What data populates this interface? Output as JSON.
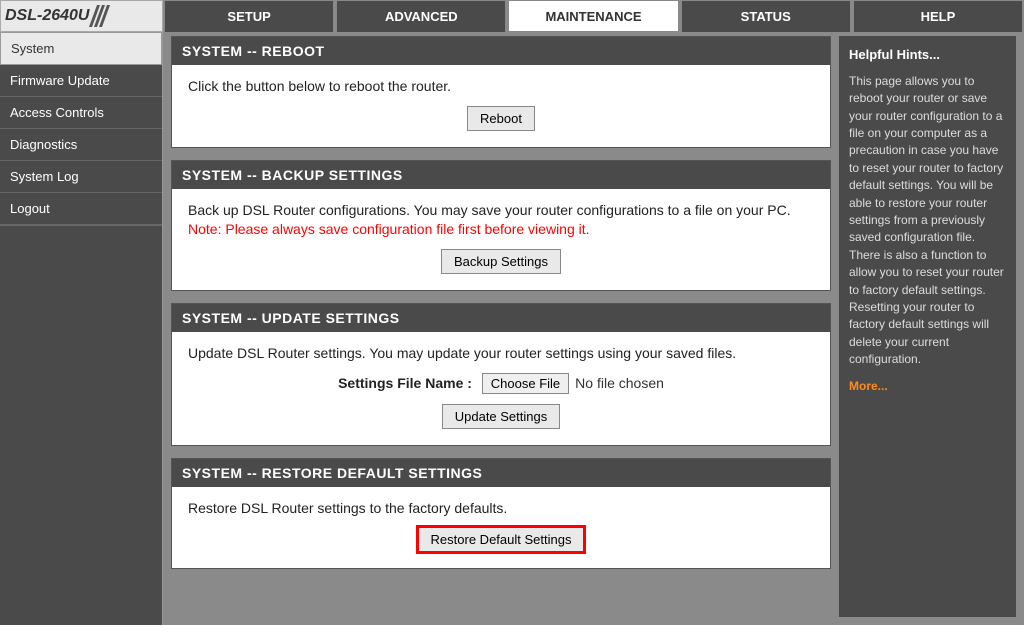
{
  "logo": {
    "model": "DSL-2640U"
  },
  "topnav": {
    "items": [
      {
        "label": "SETUP"
      },
      {
        "label": "ADVANCED"
      },
      {
        "label": "MAINTENANCE",
        "active": true
      },
      {
        "label": "STATUS"
      },
      {
        "label": "HELP"
      }
    ]
  },
  "sidebar": {
    "items": [
      {
        "label": "System",
        "active": true
      },
      {
        "label": "Firmware Update"
      },
      {
        "label": "Access Controls"
      },
      {
        "label": "Diagnostics"
      },
      {
        "label": "System Log"
      },
      {
        "label": "Logout"
      }
    ]
  },
  "panels": {
    "reboot": {
      "title": "SYSTEM -- REBOOT",
      "desc": "Click the button below to reboot the router.",
      "button": "Reboot"
    },
    "backup": {
      "title": "SYSTEM -- BACKUP SETTINGS",
      "desc": "Back up DSL Router configurations. You may save your router configurations to a file on your PC.",
      "note": "Note: Please always save configuration file first before viewing it.",
      "button": "Backup Settings"
    },
    "update": {
      "title": "SYSTEM -- UPDATE SETTINGS",
      "desc": "Update DSL Router settings. You may update your router settings using your saved files.",
      "file_label": "Settings File Name :",
      "choose_button": "Choose File",
      "file_status": "No file chosen",
      "button": "Update Settings"
    },
    "restore": {
      "title": "SYSTEM -- RESTORE DEFAULT SETTINGS",
      "desc": "Restore DSL Router settings to the factory defaults.",
      "button": "Restore Default Settings"
    }
  },
  "help": {
    "title": "Helpful Hints...",
    "body": "This page allows you to reboot your router or save your router configuration to a file on your computer as a precaution in case you have to reset your router to factory default settings. You will be able to restore your router settings from a previously saved configuration file. There is also a function to allow you to reset your router to factory default settings. Resetting your router to factory default settings will delete your current configuration.",
    "more": "More..."
  }
}
